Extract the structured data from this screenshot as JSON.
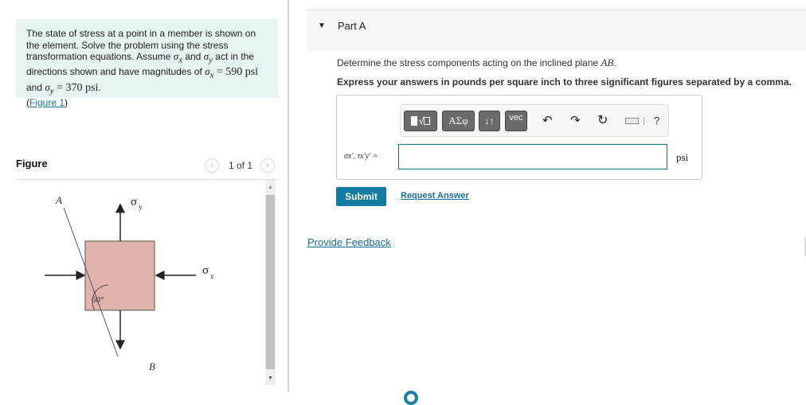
{
  "problem": {
    "text_1": "The state of stress at a point in a member is shown on the element. Solve the problem using the stress transformation equations. Assume ",
    "sigma_x": "σ",
    "sigma_x_sub": "x",
    "text_and": " and ",
    "sigma_y": "σ",
    "sigma_y_sub": "y",
    "text_2": " act in the directions shown and have magnitudes of ",
    "eq_1": " = ",
    "value_x": "590 psi",
    "text_and2": " and ",
    "eq_2": " = ",
    "value_y": "370 psi",
    "text_end": ".",
    "figure_link": "Figure 1",
    "paren_open": "(",
    "paren_close": ")"
  },
  "figure": {
    "label": "Figure",
    "pager_text": "1 of 1",
    "prev_icon": "‹",
    "next_icon": "›",
    "diagram": {
      "point_a": "A",
      "point_b": "B",
      "sigma_y_label": "σ",
      "sigma_y_sub": "y",
      "sigma_x_label": "σ",
      "sigma_x_sub": "x",
      "angle_label": "60°",
      "element_color": "#e0b4ac"
    }
  },
  "part": {
    "toggle_icon": "▼",
    "title": "Part A",
    "question_prefix": "Determine the stress components acting on the inclined plane ",
    "question_plane": "AB",
    "question_suffix": ".",
    "instruction": "Express your answers in pounds per square inch to three significant figures separated by a comma."
  },
  "toolbar": {
    "templates_icon": "■√□",
    "greek_label": "ΑΣφ",
    "arrows_label": "↓↑",
    "vec_label": "vec",
    "undo_icon": "↶",
    "redo_icon": "↷",
    "reset_icon": "↻",
    "help_label": "?"
  },
  "answer": {
    "label": "σx′, τx′y′ =",
    "value": "",
    "unit": "psi"
  },
  "actions": {
    "submit_label": "Submit",
    "request_answer_label": "Request Answer",
    "feedback_label": "Provide Feedback"
  },
  "colors": {
    "accent": "#107aa1",
    "link": "#1a6e98",
    "problem_bg": "#e6f4f4"
  }
}
